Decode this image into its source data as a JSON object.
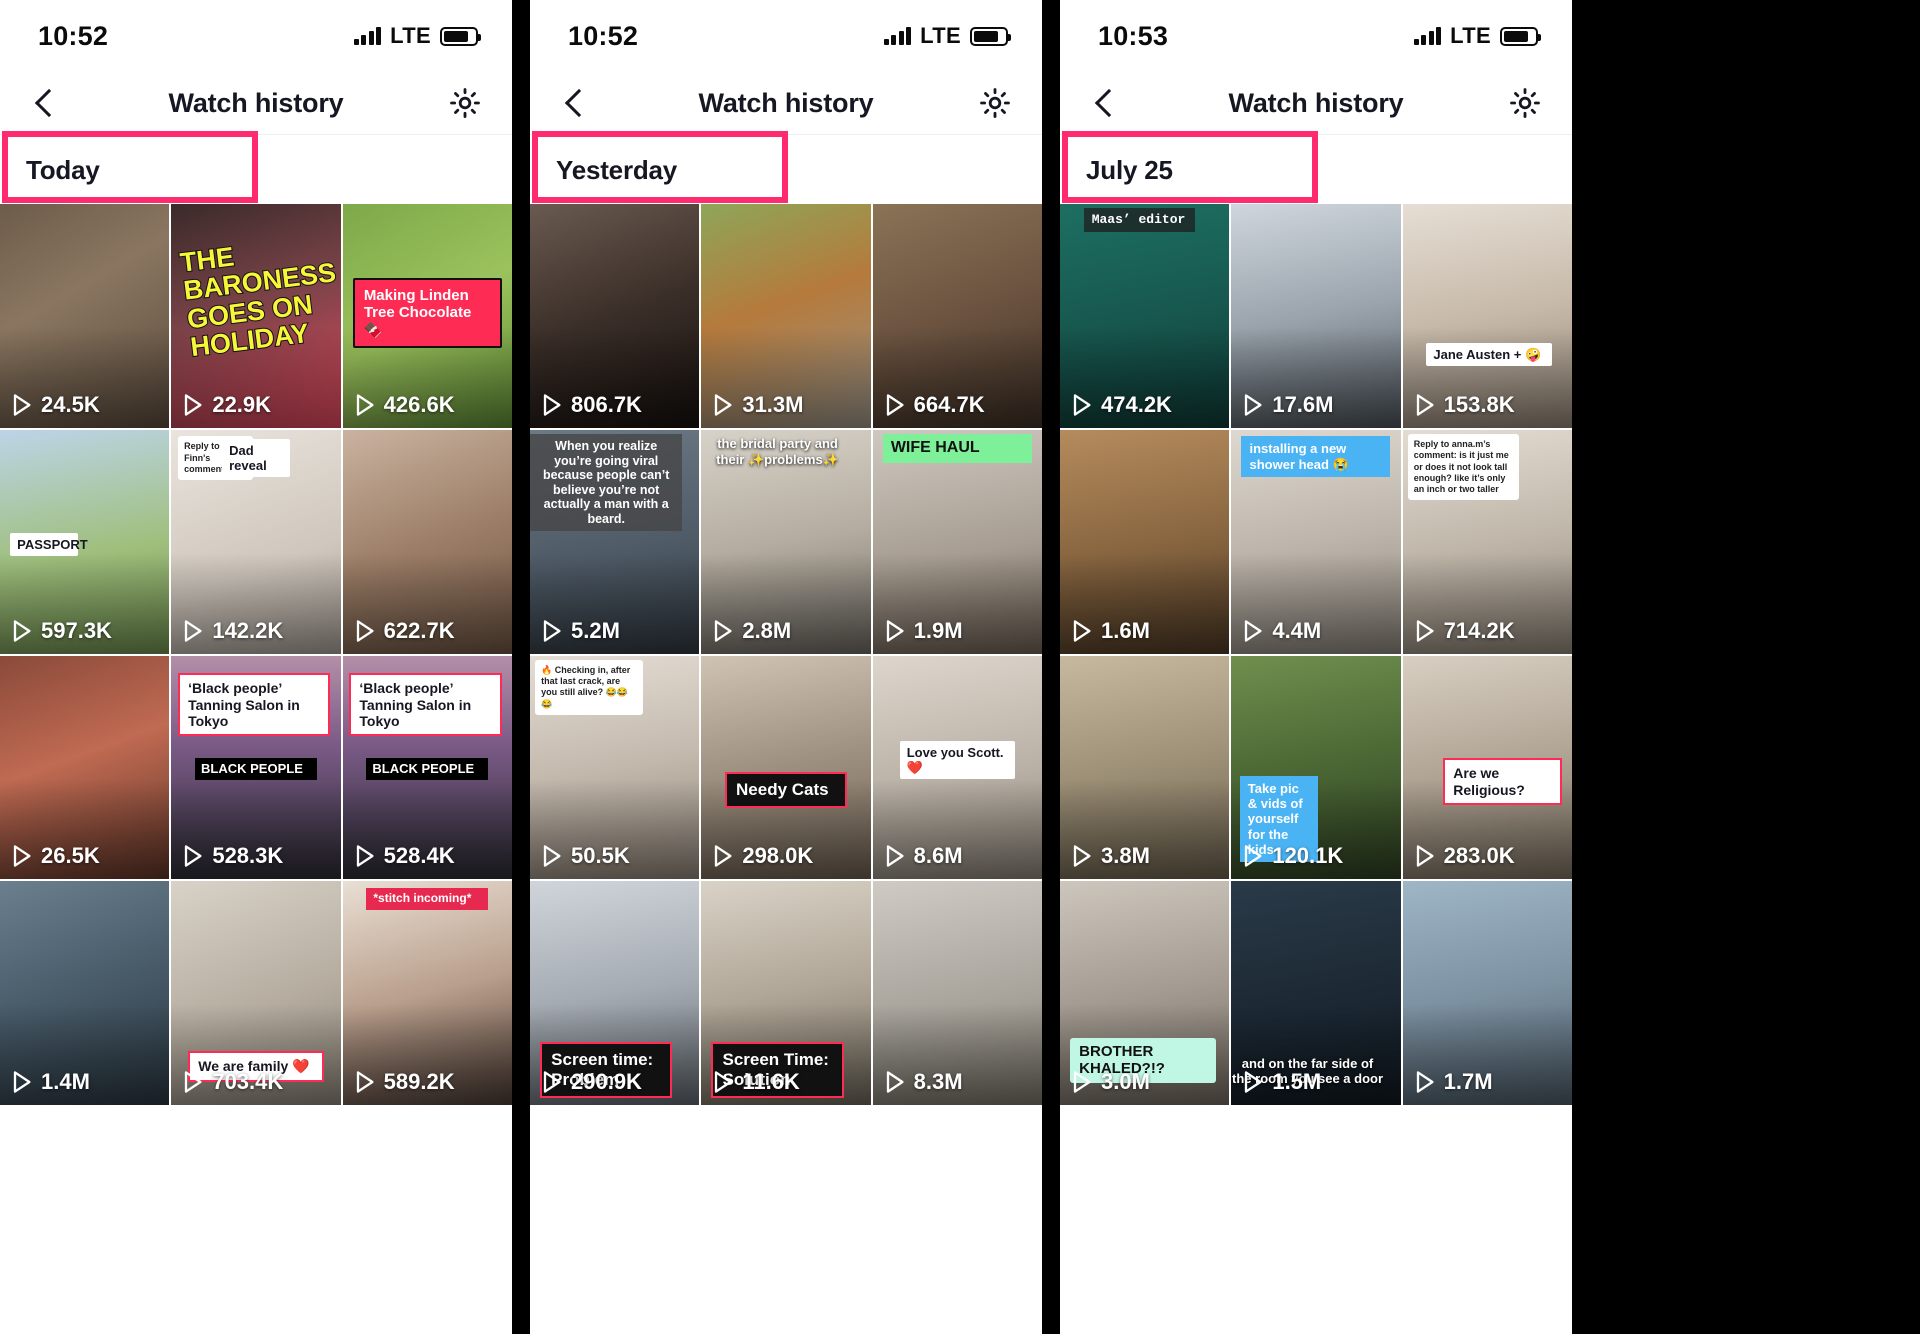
{
  "app": {
    "screens": [
      {
        "id": "screen-today",
        "status": {
          "time": "10:52",
          "network": "LTE"
        },
        "nav": {
          "title": "Watch history",
          "back_icon": "chevron-left-icon",
          "settings_icon": "gear-icon"
        },
        "date_header": "Today",
        "highlight_color": "#fe2c6e",
        "grid": [
          {
            "views": "24.5K",
            "bg": "linear-gradient(150deg,#6d5c4b 0%,#8a7660 40%,#5a4a3c 100%)",
            "captions": []
          },
          {
            "views": "22.9K",
            "bg": "linear-gradient(160deg,#3a2a2a 0%,#7a4348 45%,#e3495f 100%)",
            "captions": [
              {
                "style": "yellowtilt",
                "text": "THE BARONESS GOES ON HOLIDAY",
                "pos": "left:8%;top:16%;width:84%;"
              }
            ]
          },
          {
            "views": "426.6K",
            "bg": "linear-gradient(150deg,#7ea94a 0%,#9bc25c 50%,#5f8a36 100%)",
            "captions": [
              {
                "style": "pinkbox",
                "text": "Making Linden Tree Chocolate 🍫",
                "pos": "left:6%;top:33%;width:88%;"
              }
            ]
          },
          {
            "views": "597.3K",
            "bg": "linear-gradient(170deg,#bcd4e8 0%,#9fbf7d 55%,#6f8f4e 100%)",
            "captions": [
              {
                "style": "plainwhite",
                "text": "PASSPORT",
                "pos": "left:6%;top:46%;width:40%;"
              }
            ]
          },
          {
            "views": "142.2K",
            "bg": "linear-gradient(160deg,#e9e4dd 0%,#cfc7bd 60%,#a79f96 100%)",
            "captions": [
              {
                "style": "comment",
                "text": "Reply to Finn's comment",
                "pos": "left:4%;top:3%;width:44%;"
              },
              {
                "style": "plainwhite",
                "text": "Dad reveal",
                "pos": "left:30%;top:4%;width:40%;"
              }
            ]
          },
          {
            "views": "622.7K",
            "bg": "linear-gradient(160deg,#c9b3a0 0%,#9d7f68 50%,#6d5443 100%)",
            "captions": []
          },
          {
            "views": "26.5K",
            "bg": "linear-gradient(160deg,#8a4a3a 0%,#c06a52 45%,#5e3528 100%)",
            "captions": []
          },
          {
            "views": "528.3K",
            "bg": "linear-gradient(180deg,#b48fa8 0%,#7a5a86 40%,#2c2c34 100%)",
            "captions": [
              {
                "style": "whitebox",
                "text": "‘Black people’ Tanning Salon in Tokyo",
                "pos": "left:4%;top:8%;width:92%;"
              },
              {
                "style": "signred",
                "text": "BLACK PEOPLE",
                "pos": "left:14%;top:46%;width:72%;"
              }
            ]
          },
          {
            "views": "528.4K",
            "bg": "linear-gradient(180deg,#b48fa8 0%,#7a5a86 40%,#2c2c34 100%)",
            "captions": [
              {
                "style": "whitebox",
                "text": "‘Black people’ Tanning Salon in Tokyo",
                "pos": "left:4%;top:8%;width:92%;"
              },
              {
                "style": "signred",
                "text": "BLACK PEOPLE",
                "pos": "left:14%;top:46%;width:72%;"
              }
            ]
          },
          {
            "views": "1.4M",
            "bg": "linear-gradient(160deg,#6b7f8e 0%,#475a68 50%,#2a3740 100%)",
            "captions": []
          },
          {
            "views": "703.4K",
            "bg": "linear-gradient(160deg,#d8d2c8 0%,#b6ada0 55%,#8b8377 100%)",
            "captions": [
              {
                "style": "whitebox",
                "text": "We are family ❤️",
                "pos": "left:10%;top:76%;width:80%;"
              }
            ]
          },
          {
            "views": "589.2K",
            "bg": "linear-gradient(165deg,#e9dfd4 0%,#b99f8c 50%,#4b3a33 100%)",
            "captions": [
              {
                "style": "redline",
                "text": "*stitch incoming*",
                "pos": "left:14%;top:3%;width:72%;"
              }
            ]
          }
        ]
      },
      {
        "id": "screen-yesterday",
        "status": {
          "time": "10:52",
          "network": "LTE"
        },
        "nav": {
          "title": "Watch history",
          "back_icon": "chevron-left-icon",
          "settings_icon": "gear-icon"
        },
        "date_header": "Yesterday",
        "highlight_color": "#fe2c6e",
        "grid": [
          {
            "views": "806.7K",
            "bg": "linear-gradient(160deg,#6a5a50 0%,#3a2e28 50%,#16100d 100%)",
            "captions": []
          },
          {
            "views": "31.3M",
            "bg": "linear-gradient(160deg,#8ea659 0%,#b57a3c 45%,#9a9488 100%)",
            "captions": []
          },
          {
            "views": "664.7K",
            "bg": "linear-gradient(160deg,#8a7356 0%,#6b5340 50%,#3d2f25 100%)",
            "captions": []
          },
          {
            "views": "5.2M",
            "bg": "linear-gradient(170deg,#6c7a86 0%,#4e5a66 55%,#30383f 100%)",
            "captions": [
              {
                "style": "darkbar",
                "text": "When you realize you’re going viral because people can’t believe you’re not actually a man with a beard.",
                "pos": "left:0;top:2%;"
              }
            ]
          },
          {
            "views": "2.8M",
            "bg": "linear-gradient(170deg,#d7d2c9 0%,#b4ac9f 50%,#6e6a63 100%)",
            "captions": [
              {
                "style": "plainshadow",
                "text": "the bridal party and their ✨problems✨",
                "pos": "left:0;top:3%;"
              }
            ]
          },
          {
            "views": "1.9M",
            "bg": "linear-gradient(170deg,#cfc8c0 0%,#a79d92 55%,#6e6255 100%)",
            "captions": [
              {
                "style": "greenbox",
                "text": "WIFE HAUL",
                "pos": "left:6%;top:2%;width:88%;"
              }
            ]
          },
          {
            "views": "50.5K",
            "bg": "linear-gradient(170deg,#e4ddd4 0%,#c3b8ac 50%,#8d8377 100%)",
            "captions": [
              {
                "style": "comment",
                "text": "🔥 Checking in, after that last crack, are you still alive? 😂😂😂",
                "pos": "left:3%;top:2%;width:64%;"
              }
            ]
          },
          {
            "views": "298.0K",
            "bg": "linear-gradient(170deg,#cfc3b4 0%,#9d8f7f 50%,#6b5e50 100%)",
            "captions": [
              {
                "style": "blackbox",
                "text": "Needy Cats",
                "pos": "left:14%;top:52%;width:72%;"
              }
            ]
          },
          {
            "views": "8.6M",
            "bg": "linear-gradient(170deg,#ddd6cc 0%,#b9b1a6 55%,#8a8277 100%)",
            "captions": [
              {
                "style": "plainwhite",
                "text": "Love you Scott. ❤️",
                "pos": "left:16%;top:38%;width:68%;"
              }
            ]
          },
          {
            "views": "290.9K",
            "bg": "linear-gradient(170deg,#cfd5da 0%,#a5abb2 50%,#5f666d 100%)",
            "captions": [
              {
                "style": "blackbox",
                "text": "Screen time: Problem",
                "pos": "left:6%;top:72%;width:78%;"
              }
            ]
          },
          {
            "views": "11.6K",
            "bg": "linear-gradient(170deg,#d9d2c6 0%,#b0a697 50%,#6c6558 100%)",
            "captions": [
              {
                "style": "blackbox",
                "text": "Screen Time: Solution",
                "pos": "left:6%;top:72%;width:78%;"
              }
            ]
          },
          {
            "views": "8.3M",
            "bg": "linear-gradient(170deg,#cfcbc4 0%,#a8a49c 55%,#787368 100%)",
            "captions": []
          }
        ]
      },
      {
        "id": "screen-july-25",
        "status": {
          "time": "10:53",
          "network": "LTE"
        },
        "nav": {
          "title": "Watch history",
          "back_icon": "chevron-left-icon",
          "settings_icon": "gear-icon"
        },
        "date_header": "July 25",
        "highlight_color": "#fe2c6e",
        "grid": [
          {
            "views": "474.2K",
            "bg": "linear-gradient(170deg,#1d6f62 0%,#17584f 50%,#0f3b36 100%)",
            "captions": [
              {
                "style": "mono",
                "text": "Maas’ editor",
                "pos": "left:14%;top:2%;width:66%;"
              }
            ]
          },
          {
            "views": "17.6M",
            "bg": "linear-gradient(170deg,#cfd6dd 0%,#9aa3ac 50%,#4c5359 100%)",
            "captions": []
          },
          {
            "views": "153.8K",
            "bg": "linear-gradient(170deg,#e6ded4 0%,#c6b9a9 50%,#8f8274 100%)",
            "captions": [
              {
                "style": "plainwhite",
                "text": "Jane Austen + 🤪",
                "pos": "left:14%;top:62%;width:74%;"
              }
            ]
          },
          {
            "views": "1.6M",
            "bg": "linear-gradient(170deg,#b58b5d 0%,#8a6741 50%,#4e3a25 100%)",
            "captions": []
          },
          {
            "views": "4.4M",
            "bg": "linear-gradient(170deg,#ded8d0 0%,#bdb5ab 50%,#8b847b 100%)",
            "captions": [
              {
                "style": "bluebox",
                "text": "installing a new shower head 😭",
                "pos": "left:6%;top:3%;width:88%;"
              }
            ]
          },
          {
            "views": "714.2K",
            "bg": "linear-gradient(170deg,#e3dcd2 0%,#c0b7aa 50%,#8d8477 100%)",
            "captions": [
              {
                "style": "comment",
                "text": "Reply to anna.m’s comment: is it just me or does it not look tall enough? like it’s only an inch or two taller",
                "pos": "left:3%;top:2%;width:66%;"
              }
            ]
          },
          {
            "views": "3.8M",
            "bg": "linear-gradient(170deg,#c6b99f 0%,#9d9077 50%,#6a5f4c 100%)",
            "captions": []
          },
          {
            "views": "120.1K",
            "bg": "linear-gradient(170deg,#6f8f4e 0%,#4e6b36 45%,#2d3f22 100%)",
            "captions": [
              {
                "style": "bluebox",
                "text": "Take pic & vids of yourself for the kids",
                "pos": "left:5%;top:54%;width:46%;"
              }
            ]
          },
          {
            "views": "283.0K",
            "bg": "linear-gradient(170deg,#d8cfc2 0%,#b0a494 50%,#7a6f60 100%)",
            "captions": [
              {
                "style": "whitebox",
                "text": "Are we Religious?",
                "pos": "left:24%;top:46%;width:70%;"
              }
            ]
          },
          {
            "views": "3.0M",
            "bg": "linear-gradient(170deg,#cdc6bd 0%,#a49c92 50%,#6f675e 100%)",
            "captions": [
              {
                "style": "tealbox",
                "text": "BROTHER KHALED?!?",
                "pos": "left:6%;top:70%;width:86%;"
              }
            ]
          },
          {
            "views": "1.5M",
            "bg": "linear-gradient(170deg,#2a3a48 0%,#1d2a36 50%,#101820 100%)",
            "captions": [
              {
                "style": "plainshadow",
                "text": "and on the far side of the room you see a door",
                "pos": "left:0;top:78%;"
              }
            ]
          },
          {
            "views": "1.7M",
            "bg": "linear-gradient(170deg,#9fb6c6 0%,#7d92a2 50%,#4c5b67 100%)",
            "captions": []
          }
        ]
      }
    ]
  }
}
